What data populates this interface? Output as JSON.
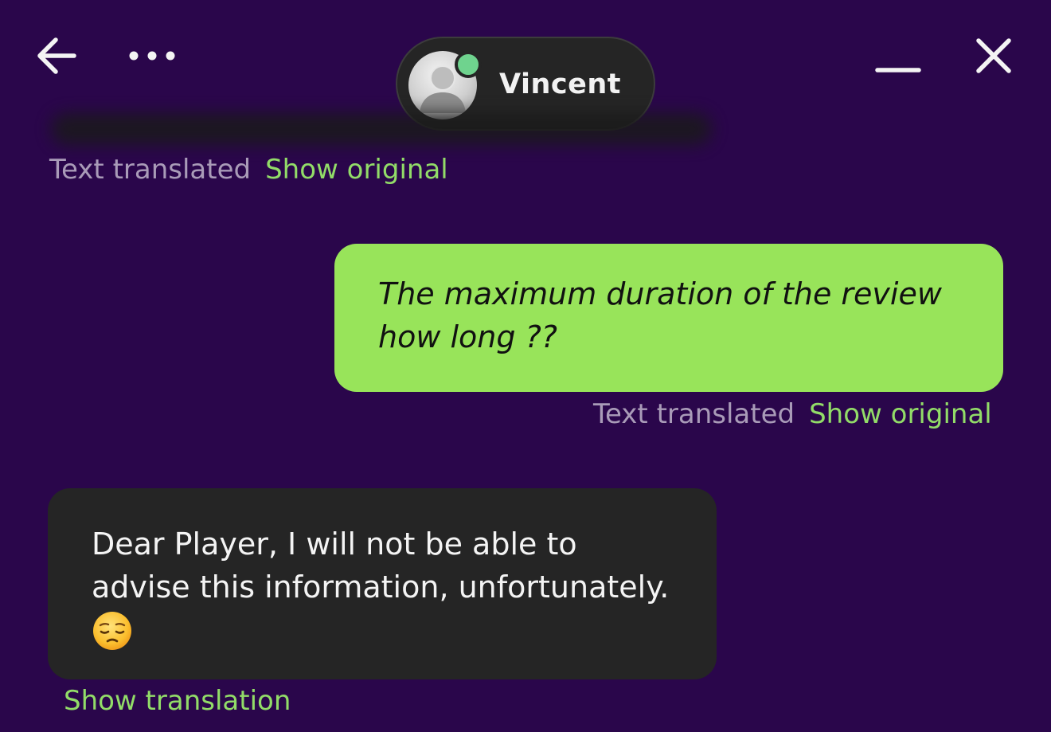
{
  "header": {
    "contact_name": "Vincent",
    "presence": "online",
    "presence_color": "#6fd38e",
    "icons": {
      "back": "arrow-left-icon",
      "more": "ellipsis-icon",
      "minimize": "minimize-icon",
      "close": "close-icon"
    }
  },
  "colors": {
    "background": "#2a064b",
    "outgoing_bubble": "#98e45a",
    "incoming_bubble": "#252525",
    "link": "#92dc68",
    "meta_text": "#a99bb8"
  },
  "messages": [
    {
      "direction": "incoming",
      "text_obscured": true,
      "meta_label": "Text translated",
      "meta_link": "Show original"
    },
    {
      "direction": "outgoing",
      "text": "The maximum duration of the review how long ??",
      "meta_label": "Text translated",
      "meta_link": "Show original"
    },
    {
      "direction": "incoming",
      "text": "Dear Player, I will not be able to advise this information, unfortunately.",
      "emoji": "pensive-face-emoji",
      "meta_link": "Show translation"
    }
  ]
}
